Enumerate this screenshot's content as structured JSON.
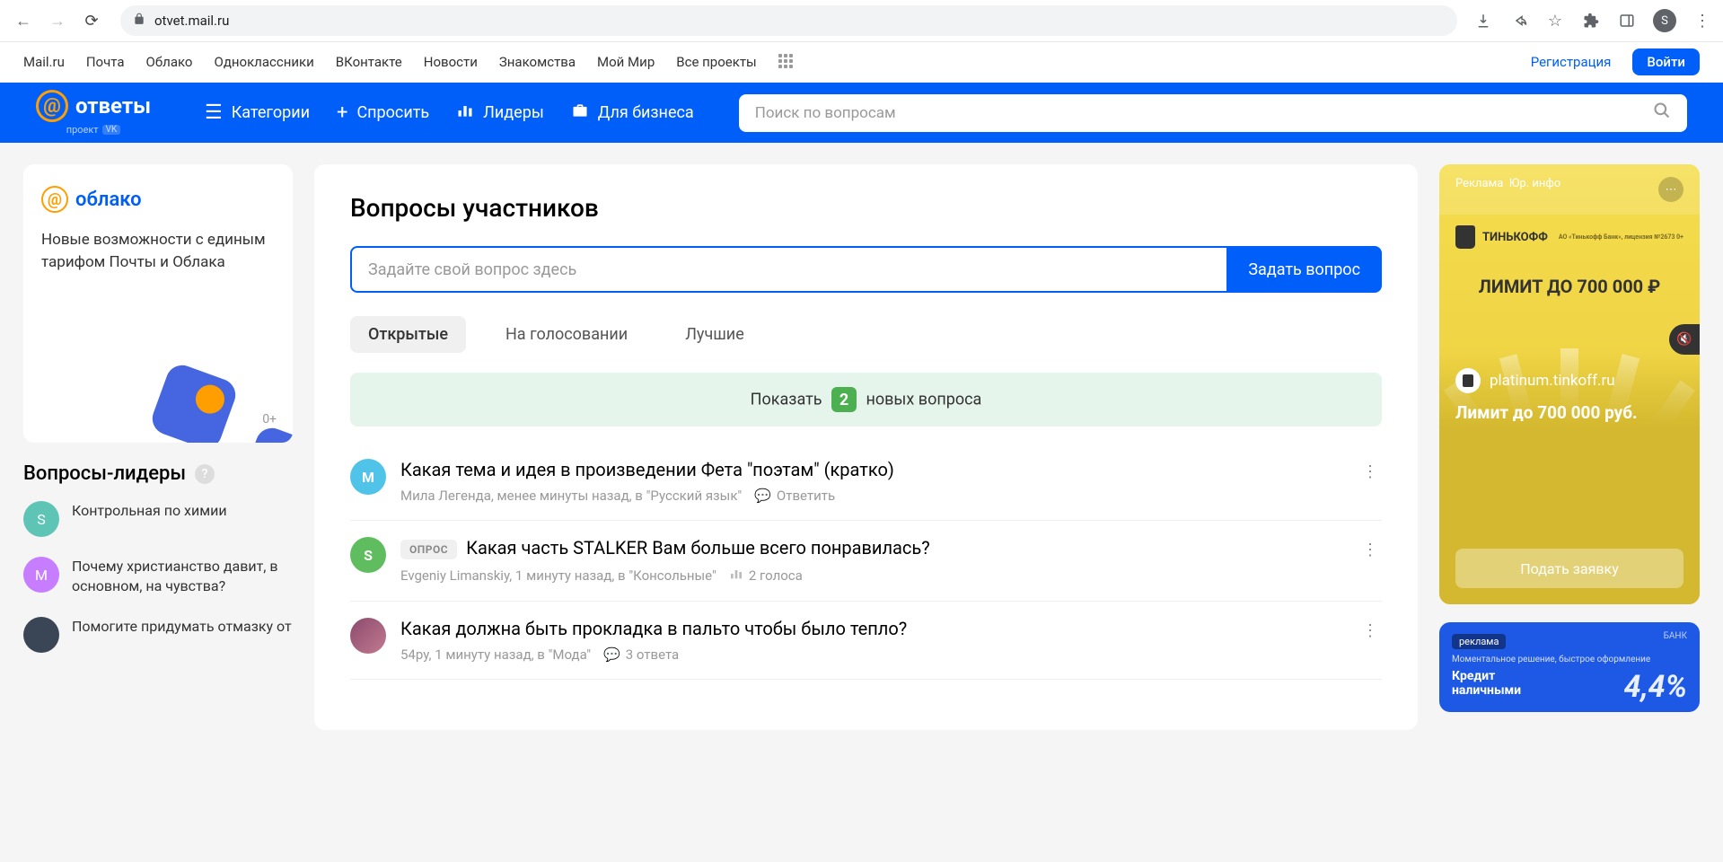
{
  "browser": {
    "url": "otvet.mail.ru",
    "profile_letter": "S"
  },
  "topnav": {
    "items": [
      "Mail.ru",
      "Почта",
      "Облако",
      "Одноклассники",
      "ВКонтакте",
      "Новости",
      "Знакомства",
      "Мой Мир",
      "Все проекты"
    ],
    "register": "Регистрация",
    "login": "Войти"
  },
  "header": {
    "logo_text": "ответы",
    "logo_sub": "проект",
    "vk": "VK",
    "categories": "Категории",
    "ask": "Спросить",
    "leaders": "Лидеры",
    "business": "Для бизнеса",
    "search_placeholder": "Поиск по вопросам"
  },
  "left_ad": {
    "logo": "облако",
    "text": "Новые возможности с единым тарифом Почты и Облака",
    "age": "0+"
  },
  "leaders": {
    "title": "Вопросы-лидеры",
    "items": [
      {
        "avatar": "S",
        "avclass": "av-teal",
        "text": "Контрольная по химии"
      },
      {
        "avatar": "М",
        "avclass": "av-purple",
        "text": "Почему христианство давит, в основном, на чувства?"
      },
      {
        "avatar": "",
        "avclass": "av-img",
        "text": "Помогите придумать отмазку от"
      }
    ]
  },
  "center": {
    "title": "Вопросы участников",
    "ask_placeholder": "Задайте свой вопрос здесь",
    "ask_button": "Задать вопрос",
    "tabs": {
      "open": "Открытые",
      "voting": "На голосовании",
      "best": "Лучшие"
    },
    "new_banner": {
      "prefix": "Показать",
      "count": "2",
      "suffix": "новых вопроса"
    },
    "questions": [
      {
        "avatar": "М",
        "avclass": "av-blue",
        "badge": "",
        "title": "Какая тема и идея в произведении Фета \"поэтам\" (кратко)",
        "meta": "Мила Легенда, менее минуты назад, в \"Русский язык\"",
        "action": "Ответить",
        "action_kind": "reply"
      },
      {
        "avatar": "S",
        "avclass": "av-green",
        "badge": "ОПРОС",
        "title": "Какая часть STALKER Вам больше всего понравилась?",
        "meta": "Evgeniy Limanskiy, 1 минуту назад, в \"Консольные\"",
        "action": "2 голоса",
        "action_kind": "votes"
      },
      {
        "avatar": "",
        "avclass": "av-photo",
        "badge": "",
        "title": "Какая должна быть прокладка в пальто чтобы было тепло?",
        "meta": "54ру, 1 минуту назад, в \"Мода\"",
        "action": "3 ответа",
        "action_kind": "answers"
      }
    ]
  },
  "right_ad": {
    "label": "Реклама",
    "juridical": "Юр. инфо",
    "brand": "ТИНЬКОФФ",
    "limit": "ЛИМИТ ДО 700 000 ₽",
    "platinum": "platinum.tinkoff.ru",
    "limit2": "Лимит до 700 000 руб.",
    "apply": "Подать заявку"
  },
  "right_ad2": {
    "tag": "реклама",
    "bank": "БАНК",
    "sub": "Моментальное решение, быстрое оформление",
    "title1": "Кредит",
    "title2": "наличными",
    "rate": "4,4%"
  }
}
